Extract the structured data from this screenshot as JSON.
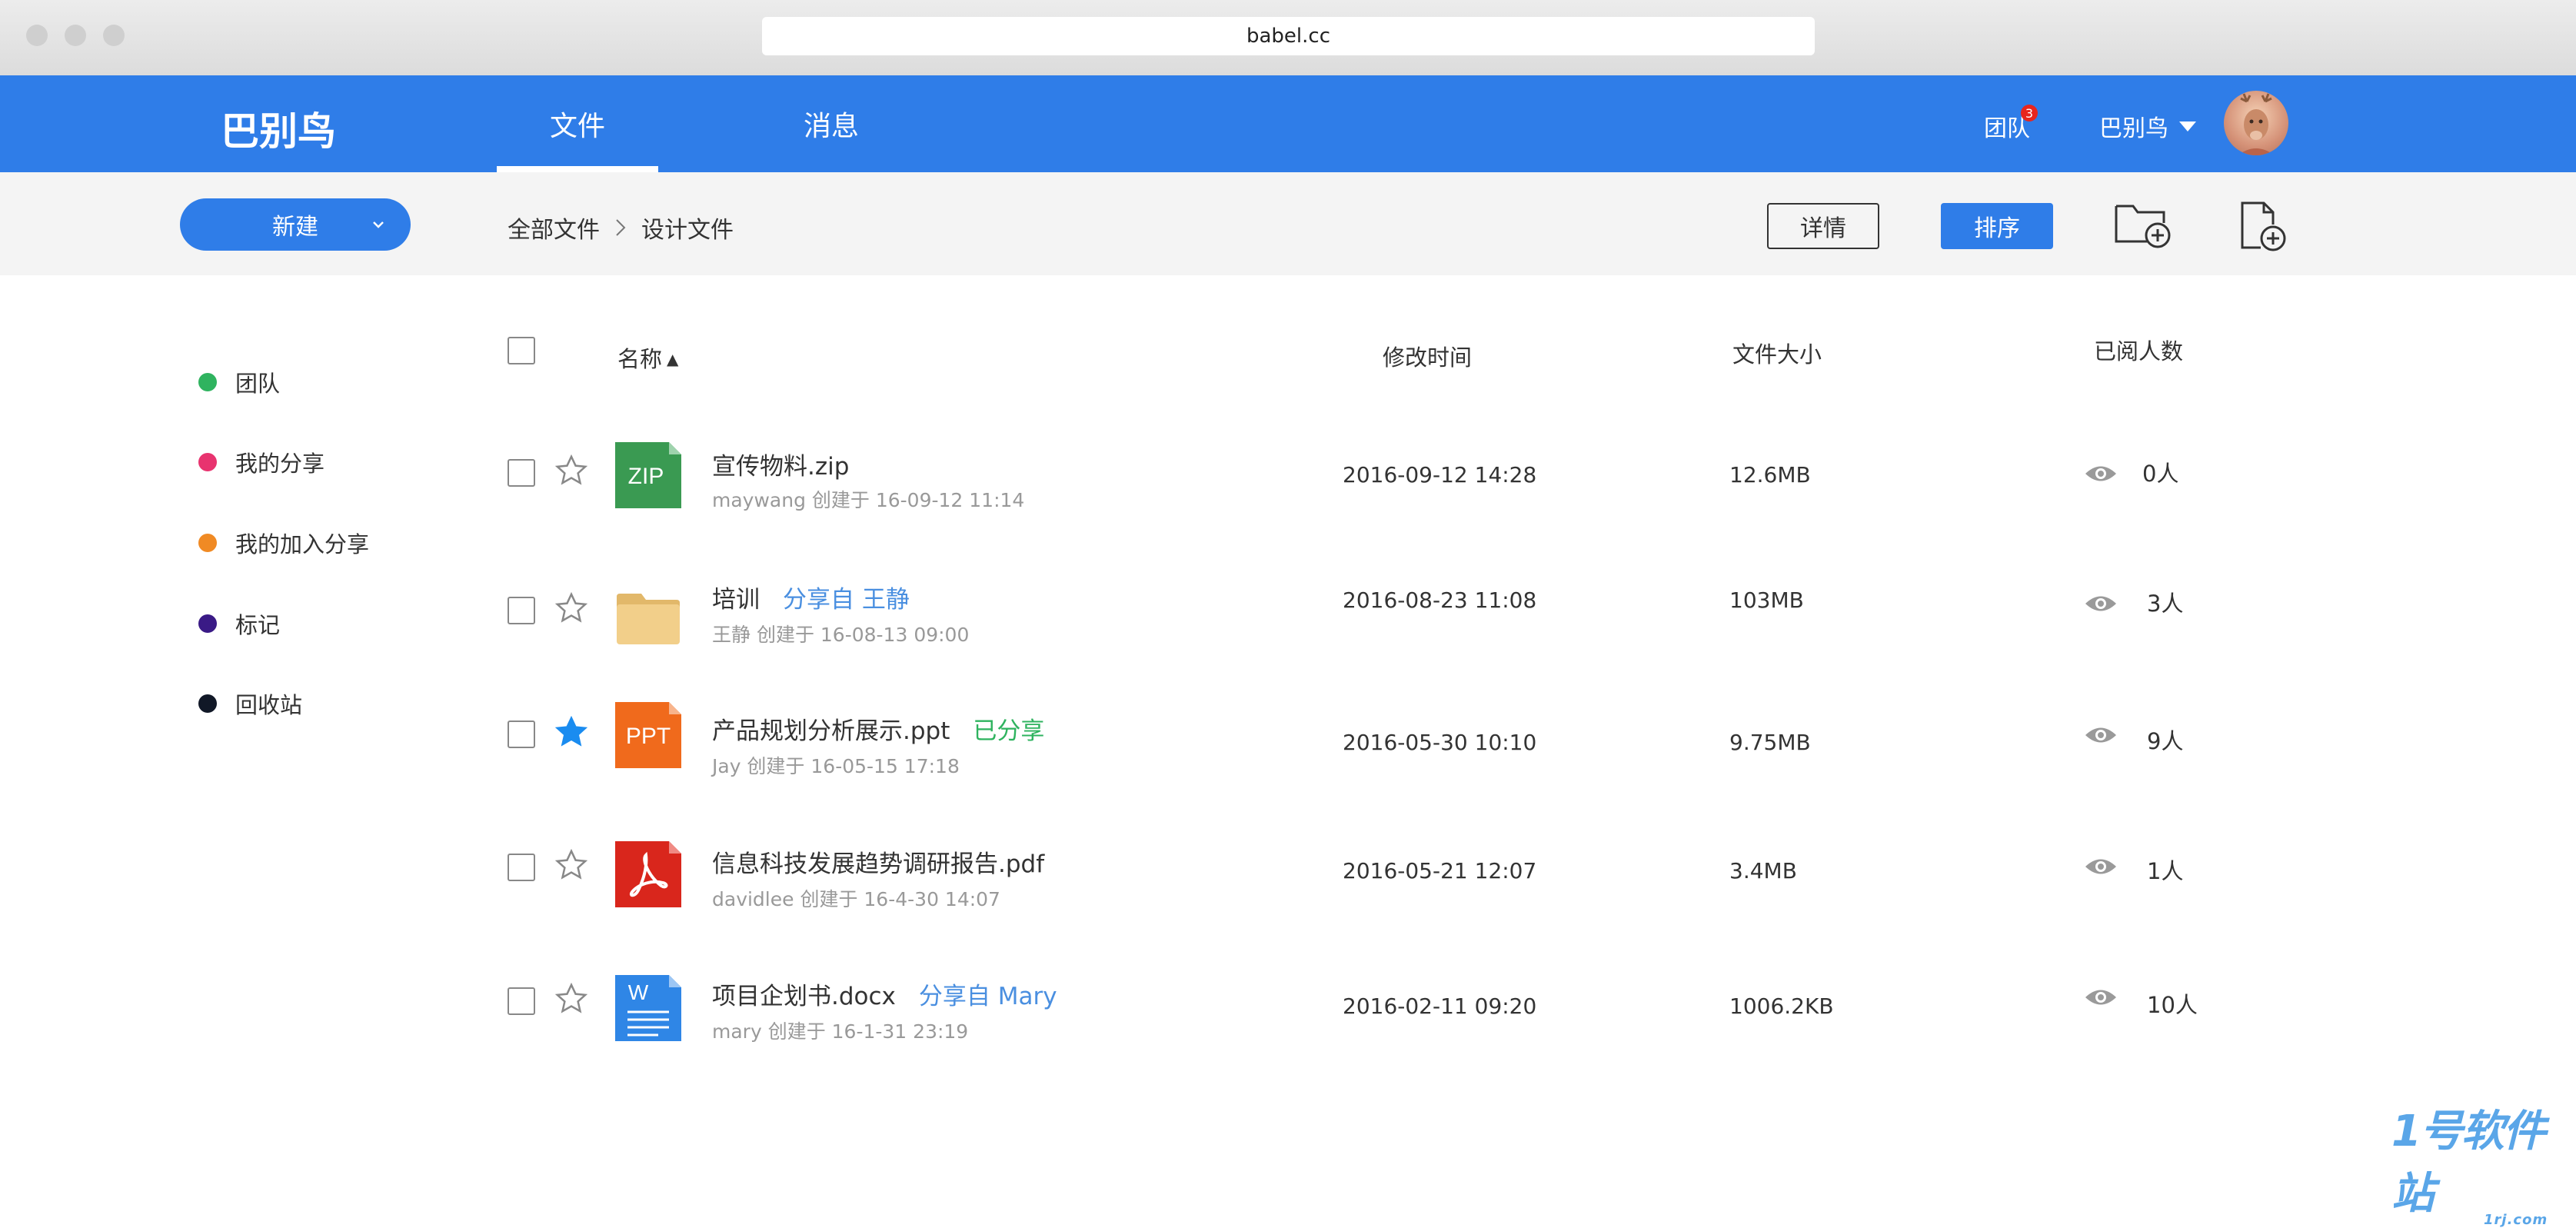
{
  "browser": {
    "url": "babel.cc"
  },
  "nav": {
    "brand": "巴别鸟",
    "tabs": [
      {
        "label": "文件",
        "active": true
      },
      {
        "label": "消息",
        "active": false
      }
    ],
    "team_label": "团队",
    "team_badge": "3",
    "user_name": "巴别鸟"
  },
  "toolbar": {
    "new_label": "新建",
    "breadcrumb": [
      "全部文件",
      "设计文件"
    ],
    "details_label": "详情",
    "sort_label": "排序"
  },
  "sidebar": {
    "items": [
      {
        "label": "团队",
        "color": "#2fb35f"
      },
      {
        "label": "我的分享",
        "color": "#e8336f"
      },
      {
        "label": "我的加入分享",
        "color": "#f08a24"
      },
      {
        "label": "标记",
        "color": "#3a1a86"
      },
      {
        "label": "回收站",
        "color": "#111827"
      }
    ]
  },
  "table": {
    "headers": {
      "name": "名称",
      "sort_arrow": "▲",
      "modified": "修改时间",
      "size": "文件大小",
      "readers": "已阅人数"
    },
    "rows": [
      {
        "name": "宣传物料.zip",
        "tag": "",
        "tag_color": "",
        "meta": "maywang 创建于 16-09-12 11:14",
        "modified": "2016-09-12 14:28",
        "size": "12.6MB",
        "readers": "0人",
        "starred": false,
        "icon": "zip-icon",
        "icon_text": "ZIP"
      },
      {
        "name": "培训",
        "tag": "分享自 王静",
        "tag_color": "#4a8fe0",
        "meta": "王静 创建于 16-08-13 09:00",
        "modified": "2016-08-23 11:08",
        "size": "103MB",
        "readers": "3人",
        "starred": false,
        "icon": "folder-icon",
        "icon_text": ""
      },
      {
        "name": "产品规划分析展示.ppt",
        "tag": "已分享",
        "tag_color": "#2fb35f",
        "meta": "Jay 创建于 16-05-15 17:18",
        "modified": "2016-05-30 10:10",
        "size": "9.75MB",
        "readers": "9人",
        "starred": true,
        "icon": "ppt-icon",
        "icon_text": "PPT"
      },
      {
        "name": "信息科技发展趋势调研报告.pdf",
        "tag": "",
        "tag_color": "",
        "meta": "davidlee 创建于 16-4-30 14:07",
        "modified": "2016-05-21 12:07",
        "size": "3.4MB",
        "readers": "1人",
        "starred": false,
        "icon": "pdf-icon",
        "icon_text": ""
      },
      {
        "name": "项目企划书.docx",
        "tag": "分享自 Mary",
        "tag_color": "#4a8fe0",
        "meta": "mary 创建于 16-1-31 23:19",
        "modified": "2016-02-11 09:20",
        "size": "1006.2KB",
        "readers": "10人",
        "starred": false,
        "icon": "word-icon",
        "icon_text": "W"
      }
    ]
  },
  "watermark": {
    "main": "1号软件站",
    "sub": "1rj.com"
  },
  "colors": {
    "primary": "#2f7de8",
    "star_active": "#1a8cf0",
    "zip": "#3a9a52",
    "ppt": "#f06a1c",
    "pdf": "#d9261c",
    "word": "#2f86e6",
    "folder": "#f2cf8a"
  }
}
